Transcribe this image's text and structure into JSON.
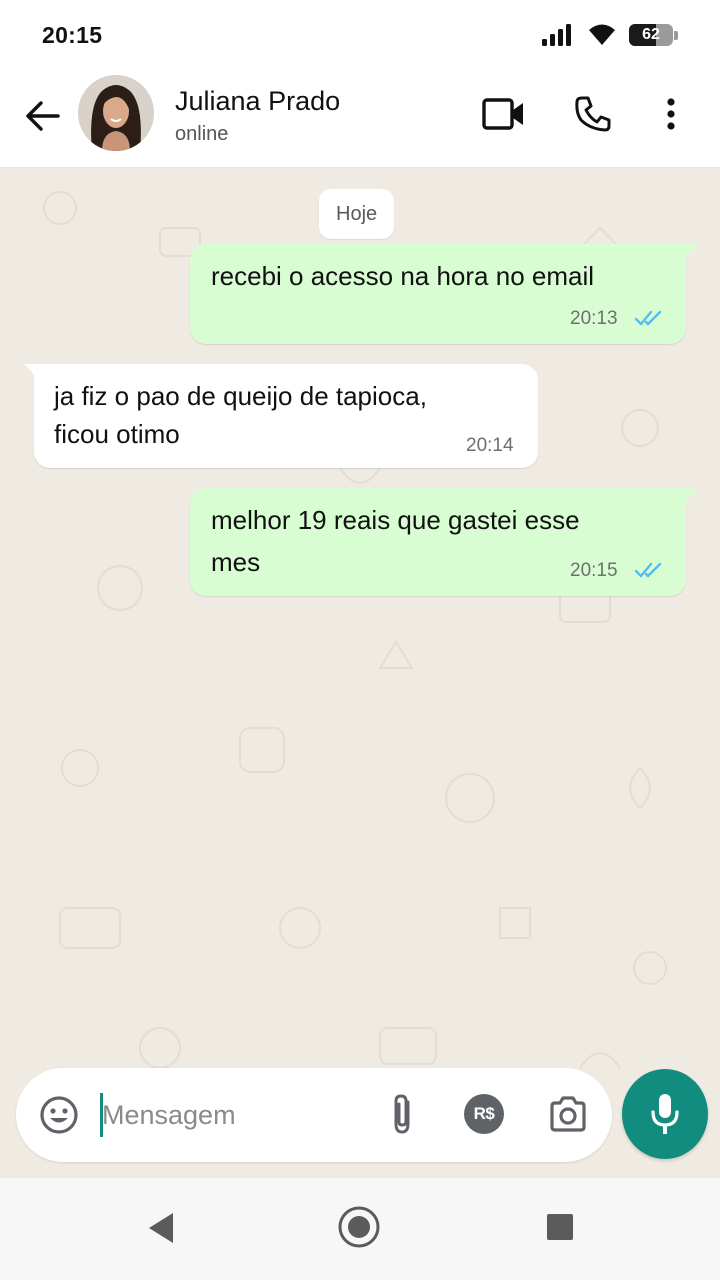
{
  "status_bar": {
    "time": "20:15",
    "battery_level": "62",
    "icons": [
      "signal-icon",
      "wifi-icon",
      "battery-icon"
    ]
  },
  "header": {
    "contact_name": "Juliana Prado",
    "contact_status": "online",
    "icons": [
      "back-arrow-icon",
      "video-call-icon",
      "phone-icon",
      "more-vert-icon"
    ]
  },
  "chat": {
    "date_label": "Hoje",
    "messages": [
      {
        "direction": "outgoing",
        "text": "recebi o acesso na hora no email",
        "time": "20:13",
        "status": "read"
      },
      {
        "direction": "incoming",
        "lines": [
          "ja fiz o pao de queijo de tapioca,",
          "ficou otimo"
        ],
        "time": "20:14"
      },
      {
        "direction": "outgoing",
        "lines": [
          "melhor 19 reais que gastei esse",
          "mes"
        ],
        "time": "20:15",
        "status": "read"
      }
    ]
  },
  "composer": {
    "placeholder": "Mensagem",
    "value": "",
    "payment_label": "R$",
    "icons": [
      "emoji-icon",
      "paperclip-icon",
      "payment-icon",
      "camera-icon",
      "mic-icon"
    ]
  },
  "navigation": {
    "icons": [
      "nav-back-icon",
      "nav-home-icon",
      "nav-recents-icon"
    ]
  },
  "colors": {
    "outgoing_bubble": "#d9fdd3",
    "incoming_bubble": "#ffffff",
    "chat_background": "#efeae2",
    "accent": "#128c7e",
    "read_ticks": "#53bdeb"
  }
}
